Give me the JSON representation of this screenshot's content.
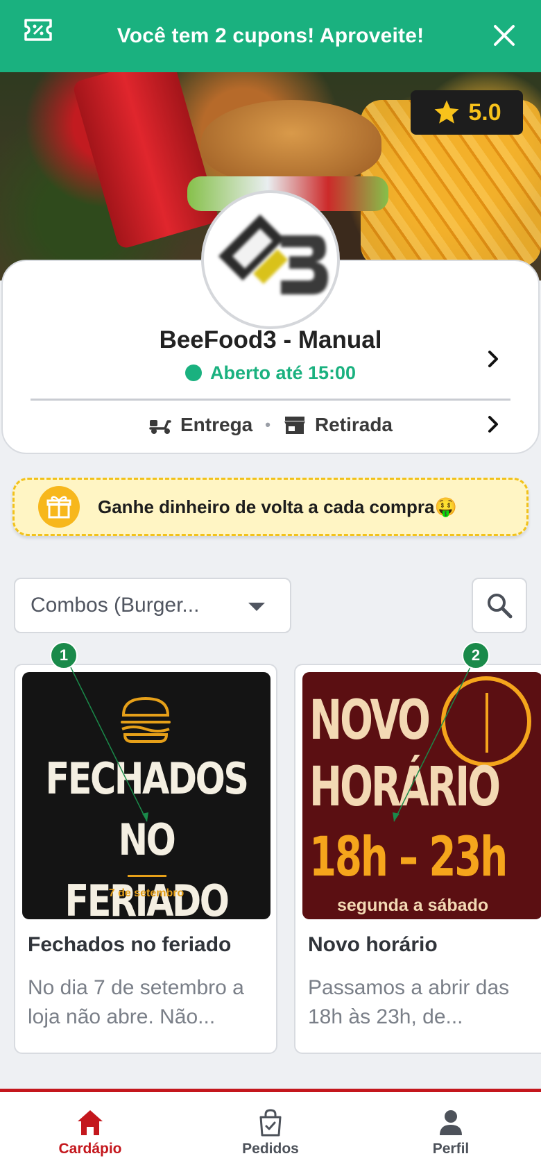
{
  "coupon_banner": {
    "text": "Você tem 2 cupons! Aproveite!",
    "icon": "ticket-icon",
    "close_icon": "close-icon",
    "background": "#1ab17f"
  },
  "store": {
    "rating": "5.0",
    "name": "BeeFood3 - Manual",
    "status": "Aberto até 15:00",
    "delivery_label": "Entrega",
    "pickup_label": "Retirada",
    "status_color": "#1ab17f"
  },
  "cashback": {
    "text": "Ganhe dinheiro de volta a cada compra🤑"
  },
  "menu_filter": {
    "selected_category": "Combos (Burger..."
  },
  "news": [
    {
      "index": "1",
      "title": "Fechados no feriado",
      "description": "No dia 7 de setembro a loja não abre. Não...",
      "image_text": [
        "FECHADOS",
        "NO FERIADO"
      ],
      "image_date": "7 de setembro"
    },
    {
      "index": "2",
      "title": "Novo horário",
      "description": "Passamos a abrir das 18h às 23h, de...",
      "image_text": [
        "NOVO",
        "HORÁRIO"
      ],
      "image_hours": "18h – 23h",
      "image_days": "segunda a sábado"
    }
  ],
  "bottom_nav": [
    {
      "label": "Cardápio",
      "icon": "home-icon",
      "active": true
    },
    {
      "label": "Pedidos",
      "icon": "shopping-bag-icon",
      "active": false
    },
    {
      "label": "Perfil",
      "icon": "user-icon",
      "active": false
    }
  ],
  "colors": {
    "brand_green": "#1ab17f",
    "brand_red": "#c4171d",
    "rating_gold": "#f8c21b",
    "cashback_bg": "#fff5c4"
  }
}
